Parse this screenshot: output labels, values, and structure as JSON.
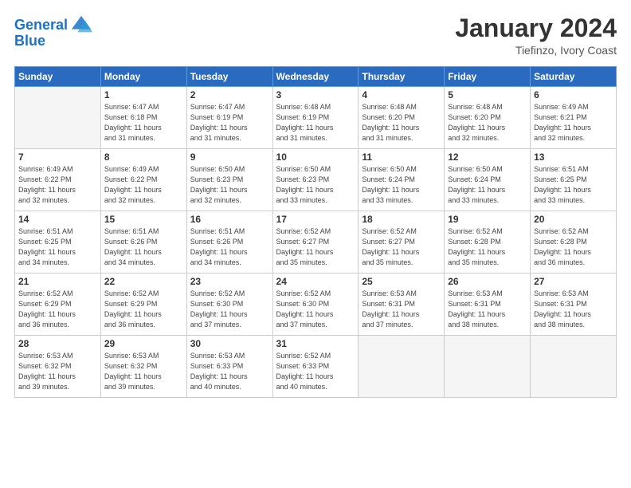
{
  "header": {
    "logo_line1": "General",
    "logo_line2": "Blue",
    "month": "January 2024",
    "location": "Tiefinzo, Ivory Coast"
  },
  "weekdays": [
    "Sunday",
    "Monday",
    "Tuesday",
    "Wednesday",
    "Thursday",
    "Friday",
    "Saturday"
  ],
  "weeks": [
    [
      {
        "day": "",
        "info": ""
      },
      {
        "day": "1",
        "info": "Sunrise: 6:47 AM\nSunset: 6:18 PM\nDaylight: 11 hours\nand 31 minutes."
      },
      {
        "day": "2",
        "info": "Sunrise: 6:47 AM\nSunset: 6:19 PM\nDaylight: 11 hours\nand 31 minutes."
      },
      {
        "day": "3",
        "info": "Sunrise: 6:48 AM\nSunset: 6:19 PM\nDaylight: 11 hours\nand 31 minutes."
      },
      {
        "day": "4",
        "info": "Sunrise: 6:48 AM\nSunset: 6:20 PM\nDaylight: 11 hours\nand 31 minutes."
      },
      {
        "day": "5",
        "info": "Sunrise: 6:48 AM\nSunset: 6:20 PM\nDaylight: 11 hours\nand 32 minutes."
      },
      {
        "day": "6",
        "info": "Sunrise: 6:49 AM\nSunset: 6:21 PM\nDaylight: 11 hours\nand 32 minutes."
      }
    ],
    [
      {
        "day": "7",
        "info": "Sunrise: 6:49 AM\nSunset: 6:22 PM\nDaylight: 11 hours\nand 32 minutes."
      },
      {
        "day": "8",
        "info": "Sunrise: 6:49 AM\nSunset: 6:22 PM\nDaylight: 11 hours\nand 32 minutes."
      },
      {
        "day": "9",
        "info": "Sunrise: 6:50 AM\nSunset: 6:23 PM\nDaylight: 11 hours\nand 32 minutes."
      },
      {
        "day": "10",
        "info": "Sunrise: 6:50 AM\nSunset: 6:23 PM\nDaylight: 11 hours\nand 33 minutes."
      },
      {
        "day": "11",
        "info": "Sunrise: 6:50 AM\nSunset: 6:24 PM\nDaylight: 11 hours\nand 33 minutes."
      },
      {
        "day": "12",
        "info": "Sunrise: 6:50 AM\nSunset: 6:24 PM\nDaylight: 11 hours\nand 33 minutes."
      },
      {
        "day": "13",
        "info": "Sunrise: 6:51 AM\nSunset: 6:25 PM\nDaylight: 11 hours\nand 33 minutes."
      }
    ],
    [
      {
        "day": "14",
        "info": "Sunrise: 6:51 AM\nSunset: 6:25 PM\nDaylight: 11 hours\nand 34 minutes."
      },
      {
        "day": "15",
        "info": "Sunrise: 6:51 AM\nSunset: 6:26 PM\nDaylight: 11 hours\nand 34 minutes."
      },
      {
        "day": "16",
        "info": "Sunrise: 6:51 AM\nSunset: 6:26 PM\nDaylight: 11 hours\nand 34 minutes."
      },
      {
        "day": "17",
        "info": "Sunrise: 6:52 AM\nSunset: 6:27 PM\nDaylight: 11 hours\nand 35 minutes."
      },
      {
        "day": "18",
        "info": "Sunrise: 6:52 AM\nSunset: 6:27 PM\nDaylight: 11 hours\nand 35 minutes."
      },
      {
        "day": "19",
        "info": "Sunrise: 6:52 AM\nSunset: 6:28 PM\nDaylight: 11 hours\nand 35 minutes."
      },
      {
        "day": "20",
        "info": "Sunrise: 6:52 AM\nSunset: 6:28 PM\nDaylight: 11 hours\nand 36 minutes."
      }
    ],
    [
      {
        "day": "21",
        "info": "Sunrise: 6:52 AM\nSunset: 6:29 PM\nDaylight: 11 hours\nand 36 minutes."
      },
      {
        "day": "22",
        "info": "Sunrise: 6:52 AM\nSunset: 6:29 PM\nDaylight: 11 hours\nand 36 minutes."
      },
      {
        "day": "23",
        "info": "Sunrise: 6:52 AM\nSunset: 6:30 PM\nDaylight: 11 hours\nand 37 minutes."
      },
      {
        "day": "24",
        "info": "Sunrise: 6:52 AM\nSunset: 6:30 PM\nDaylight: 11 hours\nand 37 minutes."
      },
      {
        "day": "25",
        "info": "Sunrise: 6:53 AM\nSunset: 6:31 PM\nDaylight: 11 hours\nand 37 minutes."
      },
      {
        "day": "26",
        "info": "Sunrise: 6:53 AM\nSunset: 6:31 PM\nDaylight: 11 hours\nand 38 minutes."
      },
      {
        "day": "27",
        "info": "Sunrise: 6:53 AM\nSunset: 6:31 PM\nDaylight: 11 hours\nand 38 minutes."
      }
    ],
    [
      {
        "day": "28",
        "info": "Sunrise: 6:53 AM\nSunset: 6:32 PM\nDaylight: 11 hours\nand 39 minutes."
      },
      {
        "day": "29",
        "info": "Sunrise: 6:53 AM\nSunset: 6:32 PM\nDaylight: 11 hours\nand 39 minutes."
      },
      {
        "day": "30",
        "info": "Sunrise: 6:53 AM\nSunset: 6:33 PM\nDaylight: 11 hours\nand 40 minutes."
      },
      {
        "day": "31",
        "info": "Sunrise: 6:52 AM\nSunset: 6:33 PM\nDaylight: 11 hours\nand 40 minutes."
      },
      {
        "day": "",
        "info": ""
      },
      {
        "day": "",
        "info": ""
      },
      {
        "day": "",
        "info": ""
      }
    ]
  ]
}
